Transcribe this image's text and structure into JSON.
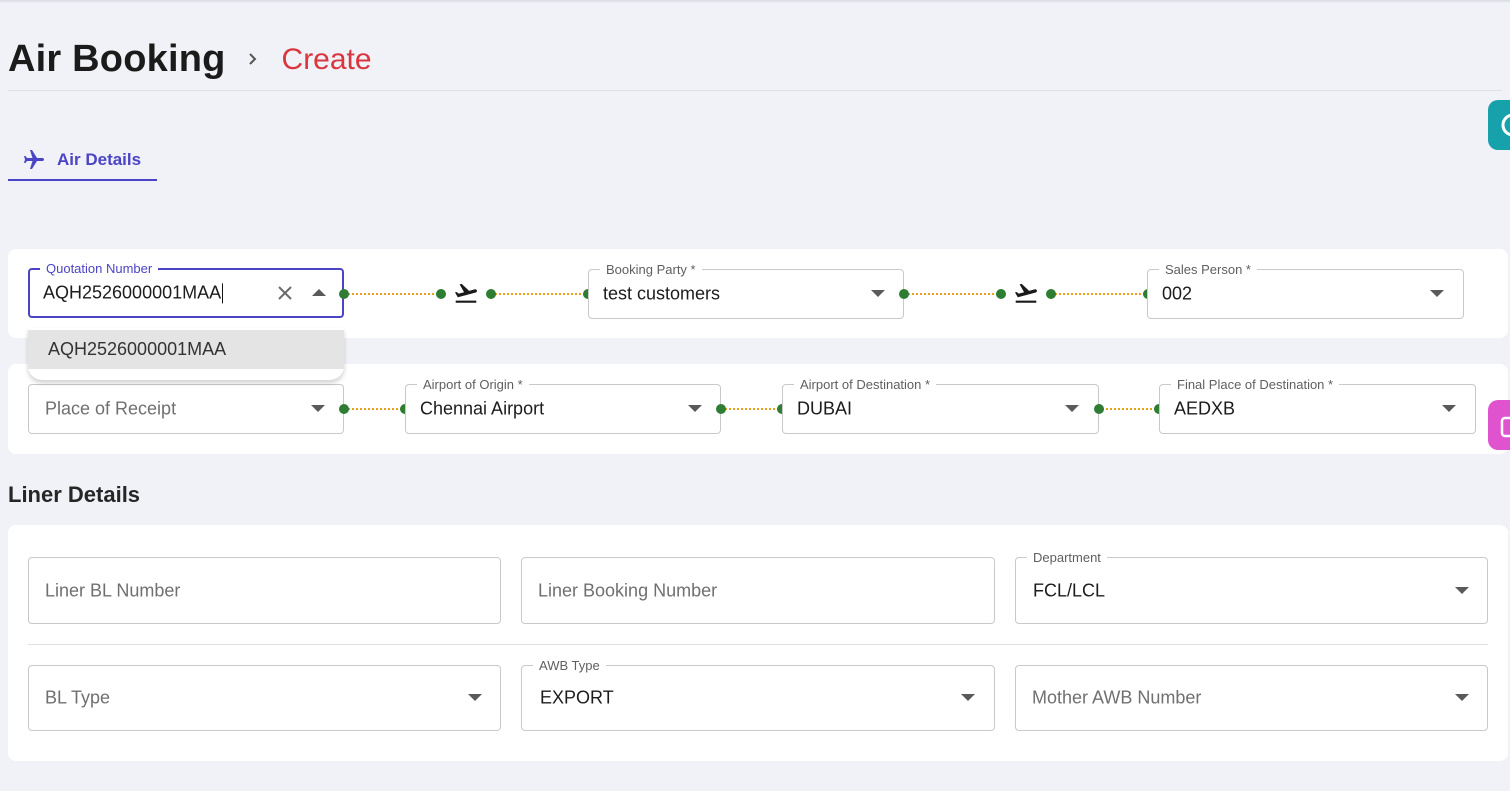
{
  "header": {
    "title": "Air Booking",
    "breadcrumb_current": "Create"
  },
  "tabs": [
    {
      "label": "Air Details",
      "icon": "airplane-icon",
      "active": true
    }
  ],
  "route_row_1": {
    "quotation_number": {
      "label": "Quotation Number",
      "value": "AQH2526000001MAA"
    },
    "booking_party": {
      "label": "Booking Party *",
      "value": "test customers"
    },
    "sales_person": {
      "label": "Sales Person *",
      "value": "002"
    }
  },
  "quotation_dropdown": {
    "options": [
      "AQH2526000001MAA"
    ]
  },
  "route_row_2": {
    "place_of_receipt": {
      "placeholder": "Place of Receipt"
    },
    "airport_of_origin": {
      "label": "Airport of Origin *",
      "value": "Chennai Airport"
    },
    "airport_of_destination": {
      "label": "Airport of Destination *",
      "value": "DUBAI"
    },
    "final_place_of_destination": {
      "label": "Final Place of Destination *",
      "value": "AEDXB"
    }
  },
  "liner_details": {
    "title": "Liner Details",
    "liner_bl_number": {
      "placeholder": "Liner BL Number"
    },
    "liner_booking_number": {
      "placeholder": "Liner Booking Number"
    },
    "department": {
      "label": "Department",
      "value": "FCL/LCL"
    },
    "bl_type": {
      "placeholder": "BL Type"
    },
    "awb_type": {
      "label": "AWB Type",
      "value": "EXPORT"
    },
    "mother_awb_number": {
      "placeholder": "Mother AWB Number"
    }
  },
  "colors": {
    "accent": "#4b44c4",
    "breadcrumb": "#d9363e",
    "connector_dot": "#2e7d32",
    "connector_line": "#e8a21a",
    "fab_teal": "#17a2ab",
    "fab_pink": "#e053cf"
  }
}
